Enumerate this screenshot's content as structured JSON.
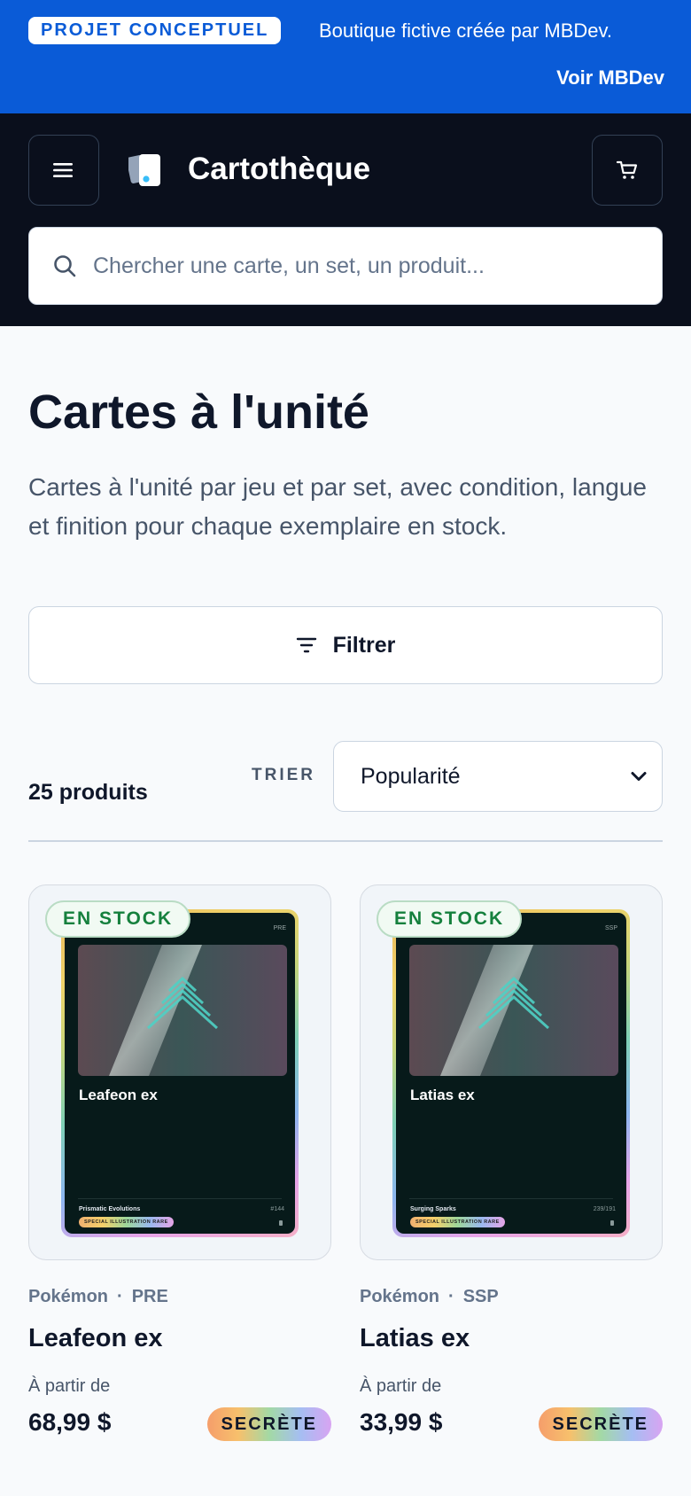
{
  "banner": {
    "badge": "PROJET CONCEPTUEL",
    "text": "Boutique fictive créée par MBDev.",
    "link": "Voir MBDev",
    "color": "#0a5bd7"
  },
  "header": {
    "brand": "Cartothèque",
    "menu_icon": "hamburger-menu-icon",
    "cart_icon": "cart-icon",
    "search_placeholder": "Chercher une carte, un set, un produit...",
    "background": "#0a0f1c"
  },
  "page": {
    "title": "Cartes à l'unité",
    "description": "Cartes à l'unité par jeu et par set, avec condition, langue et finition pour chaque exemplaire en stock."
  },
  "toolbar": {
    "filter_label": "Filtrer",
    "count_label": "25 produits",
    "sort_label": "TRIER",
    "sort_value": "Popularité"
  },
  "products": [
    {
      "badge": "EN STOCK",
      "card_name": "Leafeon ex",
      "card_set": "Prismatic Evolutions",
      "card_number": "#144",
      "card_rarity": "SPECIAL ILLUSTRATION RARE",
      "card_code": "PRE",
      "game": "Pokémon",
      "set_code": "PRE",
      "separator": "·",
      "title": "Leafeon ex",
      "from_label": "À partir de",
      "price": "68,99 $",
      "rarity": "SECRÈTE"
    },
    {
      "badge": "EN STOCK",
      "card_name": "Latias ex",
      "card_set": "Surging Sparks",
      "card_number": "239/191",
      "card_rarity": "SPECIAL ILLUSTRATION RARE",
      "card_code": "SSP",
      "game": "Pokémon",
      "set_code": "SSP",
      "separator": "·",
      "title": "Latias ex",
      "from_label": "À partir de",
      "price": "33,99 $",
      "rarity": "SECRÈTE"
    }
  ]
}
